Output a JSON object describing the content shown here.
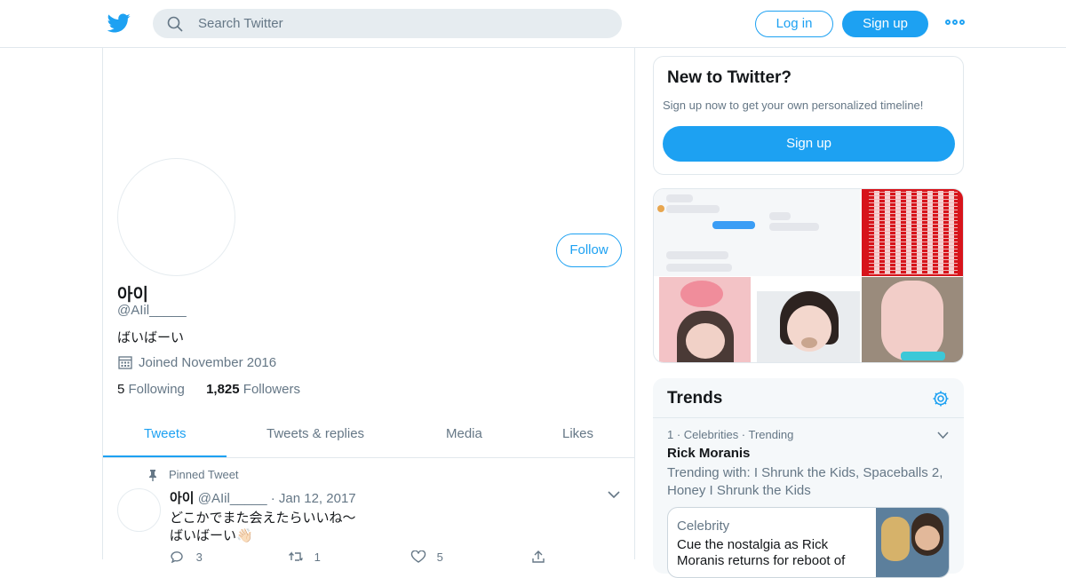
{
  "topbar": {
    "search_placeholder": "Search Twitter",
    "login_label": "Log in",
    "signup_label": "Sign up"
  },
  "profile": {
    "name": "아이",
    "handle": "@AIil_____",
    "bio": "ばいばーい",
    "joined": "Joined November 2016",
    "following_count": "5",
    "following_label": "Following",
    "followers_count": "1,825",
    "followers_label": "Followers",
    "follow_label": "Follow"
  },
  "tabs": [
    {
      "label": "Tweets"
    },
    {
      "label": "Tweets & replies"
    },
    {
      "label": "Media"
    },
    {
      "label": "Likes"
    }
  ],
  "tweet": {
    "pinned_label": "Pinned Tweet",
    "name": "아이",
    "handle": "@AIil_____",
    "date": "· Jan 12, 2017",
    "line1": "どこかでまた会えたらいいね〜",
    "line2": "ばいばーい👋🏻",
    "replies": "3",
    "retweets": "1",
    "likes": "5"
  },
  "sidebar": {
    "new_title": "New to Twitter?",
    "new_text": "Sign up now to get your own personalized timeline!",
    "signup_label": "Sign up",
    "trends_title": "Trends",
    "trend": {
      "rank_meta": "1 · Celebrities · Trending",
      "name": "Rick Moranis",
      "with": "Trending with: I Shrunk the Kids, Spaceballs 2, Honey I Shrunk the Kids",
      "card_category": "Celebrity",
      "card_text": "Cue the nostalgia as Rick Moranis returns for reboot of"
    }
  },
  "colors": {
    "accent": "#1da1f2",
    "muted_text": "#657786",
    "border": "#e1e8ed"
  }
}
